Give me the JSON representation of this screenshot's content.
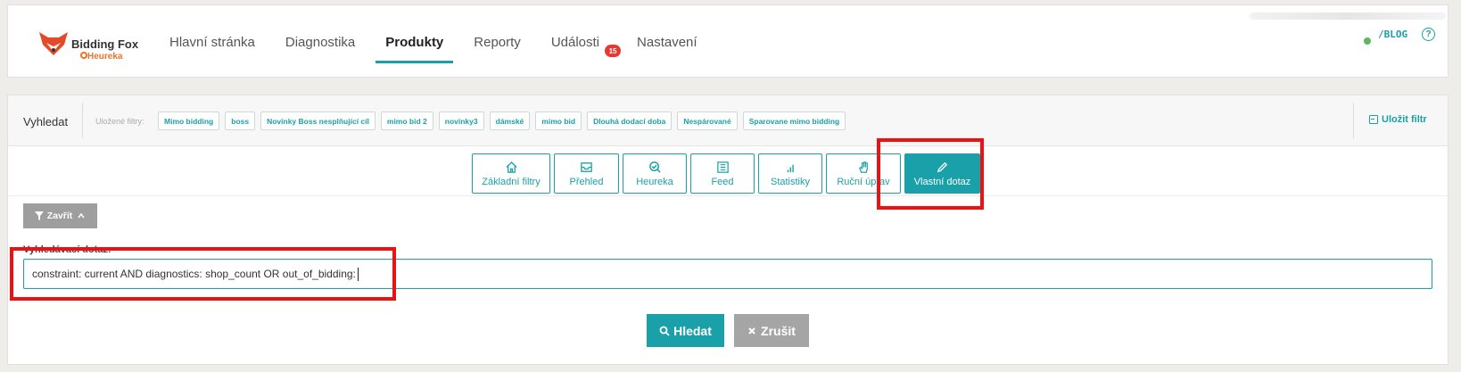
{
  "header": {
    "logo": {
      "title": "Bidding Fox",
      "subtitle": "Heureka"
    },
    "nav": [
      {
        "label": "Hlavní stránka",
        "active": false
      },
      {
        "label": "Diagnostika",
        "active": false
      },
      {
        "label": "Produkty",
        "active": true
      },
      {
        "label": "Reporty",
        "active": false
      },
      {
        "label": "Události",
        "active": false,
        "badge": "15"
      },
      {
        "label": "Nastavení",
        "active": false
      }
    ],
    "blog_link": "/BLOG",
    "help": "?"
  },
  "search": {
    "label": "Vyhledat",
    "saved_filters_label": "Uložené filtry:",
    "saved_filters": [
      "Mimo bidding",
      "boss",
      "Novinky Boss nesplňující cíl",
      "mimo bid 2",
      "novinky3",
      "dámské",
      "mimo bid",
      "Dlouhá dodací doba",
      "Nespárované",
      "Sparovane mimo bidding"
    ],
    "save_filter": "Uložit filtr"
  },
  "tabs": [
    {
      "label": "Základní filtry",
      "icon": "home-icon",
      "active": false
    },
    {
      "label": "Přehled",
      "icon": "inbox-icon",
      "active": false
    },
    {
      "label": "Heureka",
      "icon": "search-check-icon",
      "active": false
    },
    {
      "label": "Feed",
      "icon": "list-icon",
      "active": false
    },
    {
      "label": "Statistiky",
      "icon": "bar-chart-icon",
      "active": false
    },
    {
      "label": "Ruční úprav",
      "icon": "hand-icon",
      "active": false
    },
    {
      "label": "Vlastní dotaz",
      "icon": "pencil-icon",
      "active": true
    }
  ],
  "query": {
    "close_label": "Zavřít",
    "label": "Vyhledávací dotaz:",
    "value": "constraint: current AND diagnostics: shop_count OR out_of_bidding:"
  },
  "actions": {
    "search": "Hledat",
    "cancel": "Zrušit"
  },
  "colors": {
    "accent": "#1aa0a8",
    "badge": "#e53935",
    "highlight": "#ee1111",
    "fox": "#e24a28"
  }
}
